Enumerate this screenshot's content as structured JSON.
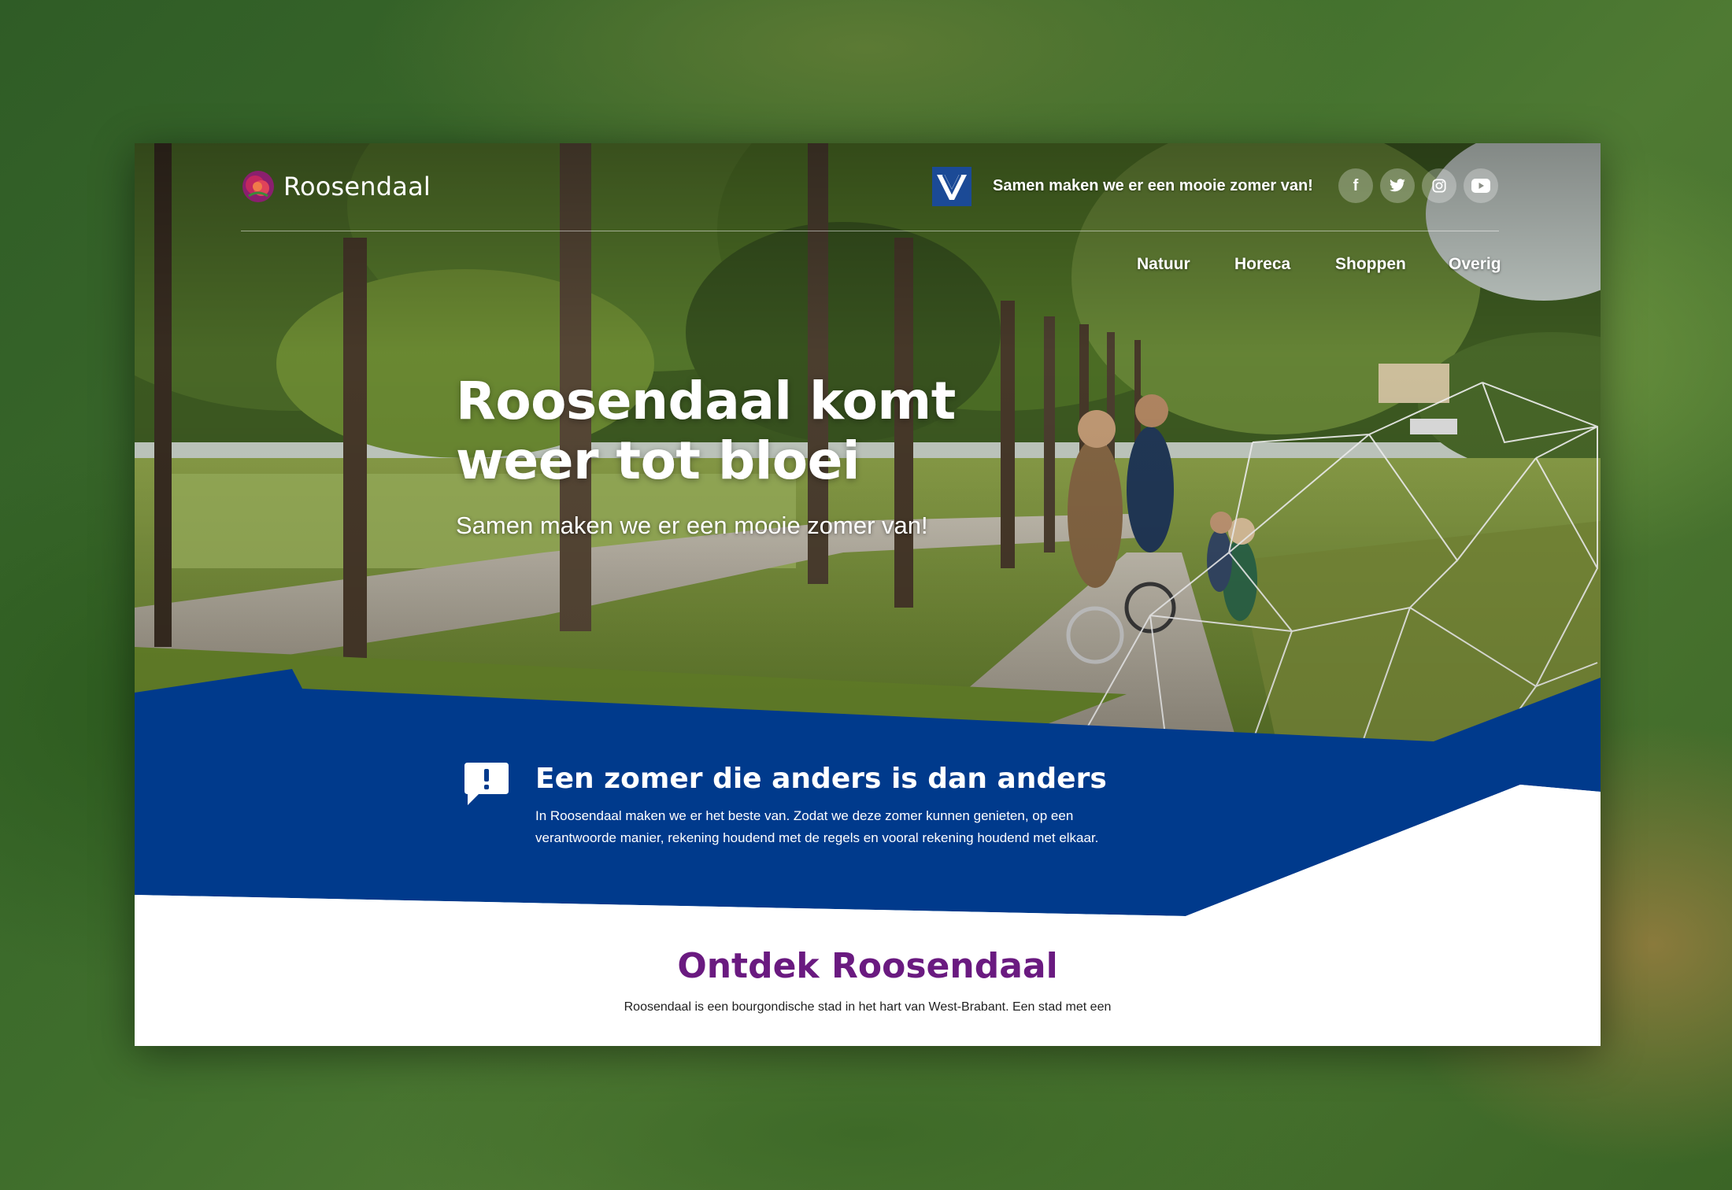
{
  "brand": {
    "name": "Roosendaal"
  },
  "header": {
    "tagline": "Samen maken we er een mooie zomer van!",
    "social": [
      {
        "icon": "facebook-icon"
      },
      {
        "icon": "twitter-icon"
      },
      {
        "icon": "instagram-icon"
      },
      {
        "icon": "youtube-icon"
      }
    ]
  },
  "nav": {
    "items": [
      "Natuur",
      "Horeca",
      "Shoppen",
      "Overig"
    ]
  },
  "hero": {
    "title_line1": "Roosendaal komt",
    "title_line2": "weer tot bloei",
    "subtitle": "Samen maken we er een mooie zomer van!"
  },
  "notice": {
    "icon": "speech-bubble-exclamation-icon",
    "title": "Een zomer die anders is dan anders",
    "text_line1": "In Roosendaal maken we er het beste van. Zodat we deze zomer kunnen genieten, op een",
    "text_line2": "verantwoorde manier, rekening houdend met de regels en vooral rekening houdend met elkaar."
  },
  "discover": {
    "title": "Ontdek Roosendaal",
    "text": "Roosendaal is een bourgondische stad in het hart van West-Brabant. Een stad met een"
  },
  "colors": {
    "brand_blue": "#003a8c",
    "accent_purple": "#6a1a80",
    "white": "#ffffff"
  }
}
